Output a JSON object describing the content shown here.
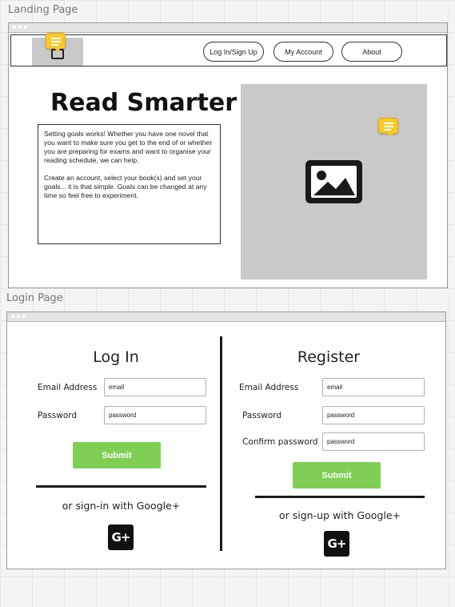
{
  "landing": {
    "frame_title": "Landing Page",
    "nav": {
      "login_signup": "Log In/Sign Up",
      "my_account": "My Account",
      "about": "About"
    },
    "hero_title": "Read Smarter",
    "intro_paragraph_1": "Setting goals works!  Whether you have one novel that you want to make sure you get to the end of or whether you are preparing for exams and want to organise your reading schedule, we can help.",
    "intro_paragraph_2": "Create an account, select your book(s) and set your goals... it is that simple.  Goals can be changed at any time so feel free to experiment.",
    "icons": [
      "image-icon",
      "comment-icon",
      "logo-icon"
    ]
  },
  "login_page": {
    "frame_title": "Login Page",
    "login": {
      "title": "Log In",
      "email_label": "Email Address",
      "email_value": "email",
      "password_label": "Password",
      "password_value": "password",
      "submit": "Submit",
      "alt": "or sign-in with Google+",
      "gplus": "G+"
    },
    "register": {
      "title": "Register",
      "email_label": "Email Address",
      "email_value": "email",
      "password_label": "Password",
      "password_value": "password",
      "confirm_label": "Confirm password",
      "confirm_value": "password",
      "submit": "Submit",
      "alt": "or sign-up with Google+",
      "gplus": "G+"
    }
  },
  "colors": {
    "submit_green": "#7ecf54",
    "comment_yellow": "#f9c928",
    "placeholder_grey": "#c9c9c9"
  }
}
